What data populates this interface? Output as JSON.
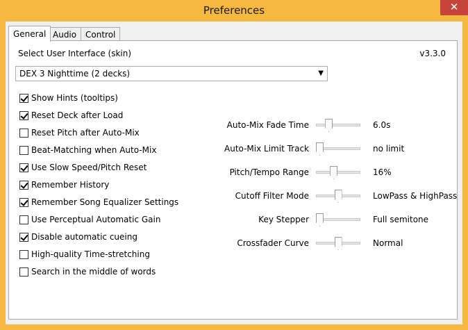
{
  "window": {
    "title": "Preferences",
    "close_glyph": "✕"
  },
  "tabs": [
    {
      "label": "General",
      "active": true
    },
    {
      "label": "Audio",
      "active": false
    },
    {
      "label": "Control",
      "active": false
    }
  ],
  "general": {
    "skin_label": "Select User Interface (skin)",
    "version": "v3.3.0",
    "skin_value": "DEX 3 Nighttime (2 decks)",
    "checkboxes": [
      {
        "label": "Show Hints (tooltips)",
        "checked": true
      },
      {
        "label": "Reset Deck after Load",
        "checked": true
      },
      {
        "label": "Reset Pitch after Auto-Mix",
        "checked": false
      },
      {
        "label": "Beat-Matching when Auto-Mix",
        "checked": false
      },
      {
        "label": "Use Slow Speed/Pitch Reset",
        "checked": true
      },
      {
        "label": "Remember History",
        "checked": true
      },
      {
        "label": "Remember Song Equalizer Settings",
        "checked": true
      },
      {
        "label": "Use Perceptual Automatic Gain",
        "checked": false
      },
      {
        "label": "Disable automatic cueing",
        "checked": true
      },
      {
        "label": "High-quality Time-stretching",
        "checked": false
      },
      {
        "label": "Search in the middle of words",
        "checked": false
      }
    ],
    "sliders": [
      {
        "label": "Auto-Mix Fade Time",
        "value": "6.0s",
        "level": 0.25
      },
      {
        "label": "Auto-Mix Limit Track",
        "value": "no limit",
        "level": 0.0
      },
      {
        "label": "Pitch/Tempo Range",
        "value": "16%",
        "level": 0.38
      },
      {
        "label": "Cutoff Filter Mode",
        "value": "LowPass & HighPass",
        "level": 0.5
      },
      {
        "label": "Key Stepper",
        "value": "Full semitone",
        "level": 0.0
      },
      {
        "label": "Crossfader Curve",
        "value": "Normal",
        "level": 0.5
      }
    ]
  }
}
